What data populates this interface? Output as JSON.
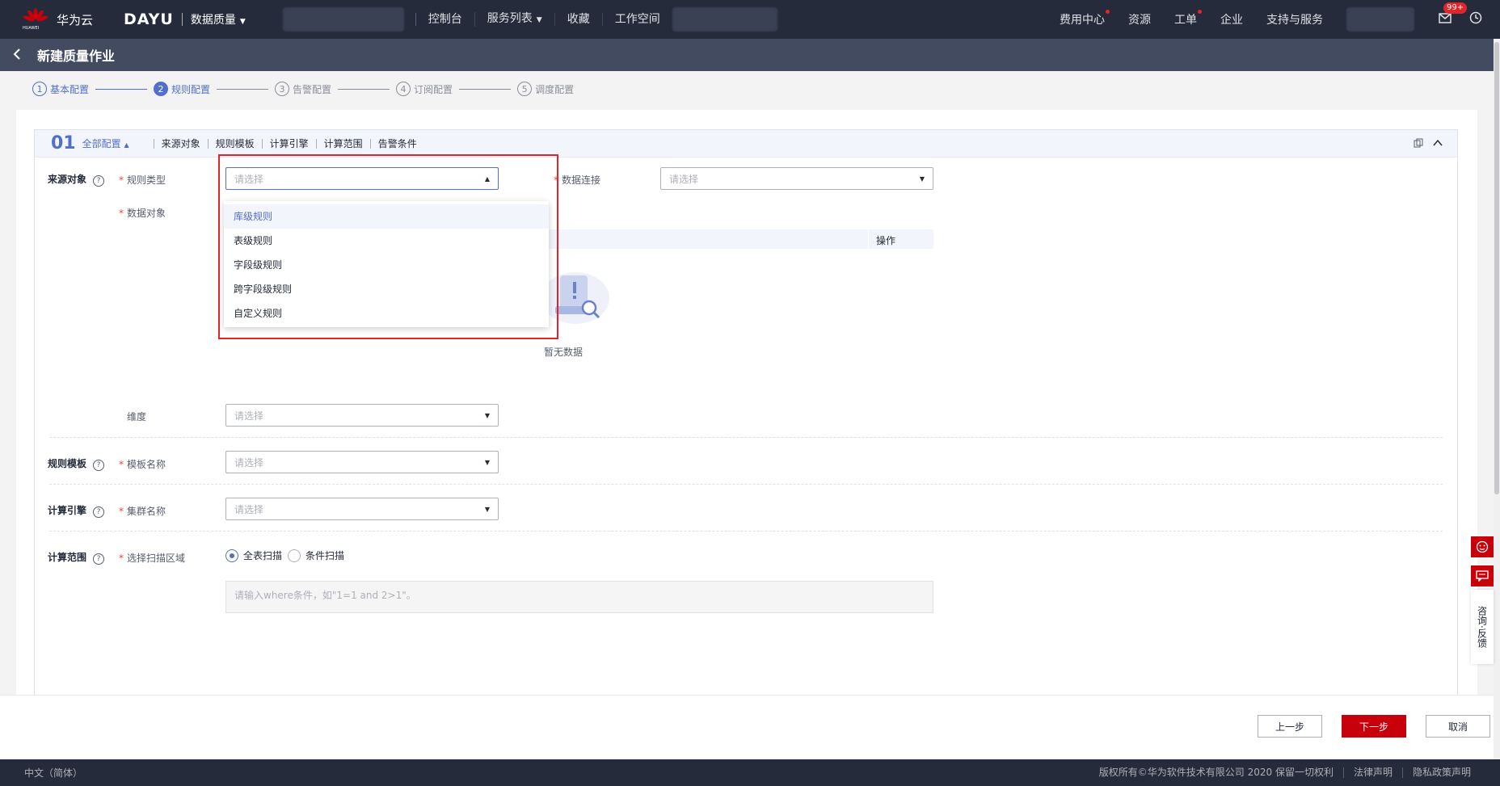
{
  "topnav": {
    "brand_sub": "HUAWEI",
    "brand": "华为云",
    "app": "DAYU",
    "module": "数据质量",
    "links": [
      "控制台",
      "服务列表",
      "收藏",
      "工作空间"
    ],
    "right": [
      "费用中心",
      "资源",
      "工单",
      "企业",
      "支持与服务"
    ],
    "badge": "99+"
  },
  "titlebar": {
    "title": "新建质量作业"
  },
  "steps": [
    {
      "num": "1",
      "label": "基本配置"
    },
    {
      "num": "2",
      "label": "规则配置"
    },
    {
      "num": "3",
      "label": "告警配置"
    },
    {
      "num": "4",
      "label": "订阅配置"
    },
    {
      "num": "5",
      "label": "调度配置"
    }
  ],
  "section": {
    "num": "01",
    "all": "全部配置",
    "anchors": [
      "来源对象",
      "规则模板",
      "计算引擎",
      "计算范围",
      "告警条件"
    ]
  },
  "form": {
    "source_label": "来源对象",
    "rule_type_label": "规则类型",
    "rule_type_placeholder": "请选择",
    "data_conn_label": "数据连接",
    "data_conn_placeholder": "请选择",
    "data_obj_label": "数据对象",
    "table_op": "操作",
    "empty": "暂无数据",
    "dimension_label": "维度",
    "dimension_placeholder": "请选择",
    "template_section": "规则模板",
    "template_label": "模板名称",
    "template_placeholder": "请选择",
    "engine_section": "计算引擎",
    "engine_label": "集群名称",
    "engine_placeholder": "请选择",
    "range_section": "计算范围",
    "range_label": "选择扫描区域",
    "radio_full": "全表扫描",
    "radio_cond": "条件扫描",
    "where_placeholder": "请输入where条件，如\"1=1 and 2>1\"。"
  },
  "dropdown": {
    "options": [
      "库级规则",
      "表级规则",
      "字段级规则",
      "跨字段级规则",
      "自定义规则"
    ],
    "selected_index": 0
  },
  "buttons": {
    "prev": "上一步",
    "next": "下一步",
    "cancel": "取消"
  },
  "footer": {
    "lang": "中文（简体）",
    "copyright": "版权所有©华为软件技术有限公司 2020 保留一切权利",
    "legal": "法律声明",
    "privacy": "隐私政策声明"
  },
  "side": {
    "consult": "咨询·反馈"
  },
  "colors": {
    "nav": "#252b3a",
    "accent": "#526ecc",
    "brand_red": "#c7000b",
    "highlight": "#e0262d"
  }
}
